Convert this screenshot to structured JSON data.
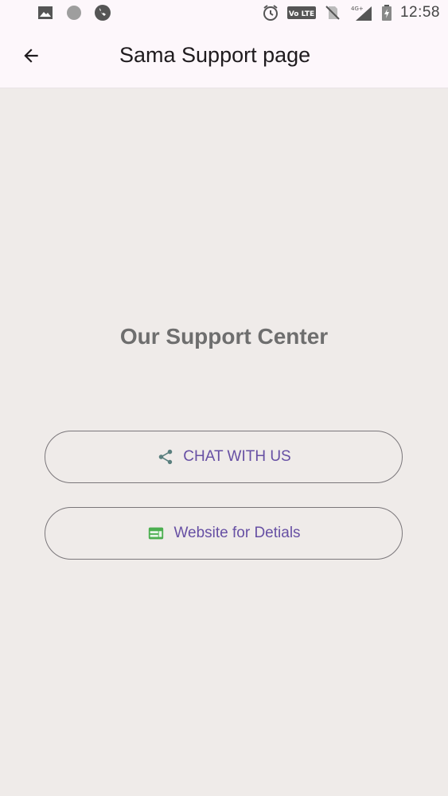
{
  "status_bar": {
    "time": "12:58",
    "icons": [
      "image-icon",
      "circle-icon",
      "viber-icon",
      "alarm-icon",
      "volte-icon",
      "no-sim-icon",
      "signal-4g-icon",
      "battery-icon"
    ],
    "volte_label": "Vo LTE",
    "network_label": "4G+"
  },
  "app_bar": {
    "title": "Sama Support page",
    "back_icon": "back-arrow-icon"
  },
  "main": {
    "heading": "Our Support Center",
    "buttons": [
      {
        "label": "CHAT WITH US",
        "icon": "share-icon"
      },
      {
        "label": "Website for Detials",
        "icon": "web-icon"
      }
    ]
  },
  "colors": {
    "background": "#efebe9",
    "app_bar": "#fdf7fb",
    "button_text": "#6750a4",
    "heading": "#6e6e6e",
    "share_icon": "#5a7f7e",
    "web_icon": "#4caf50"
  }
}
